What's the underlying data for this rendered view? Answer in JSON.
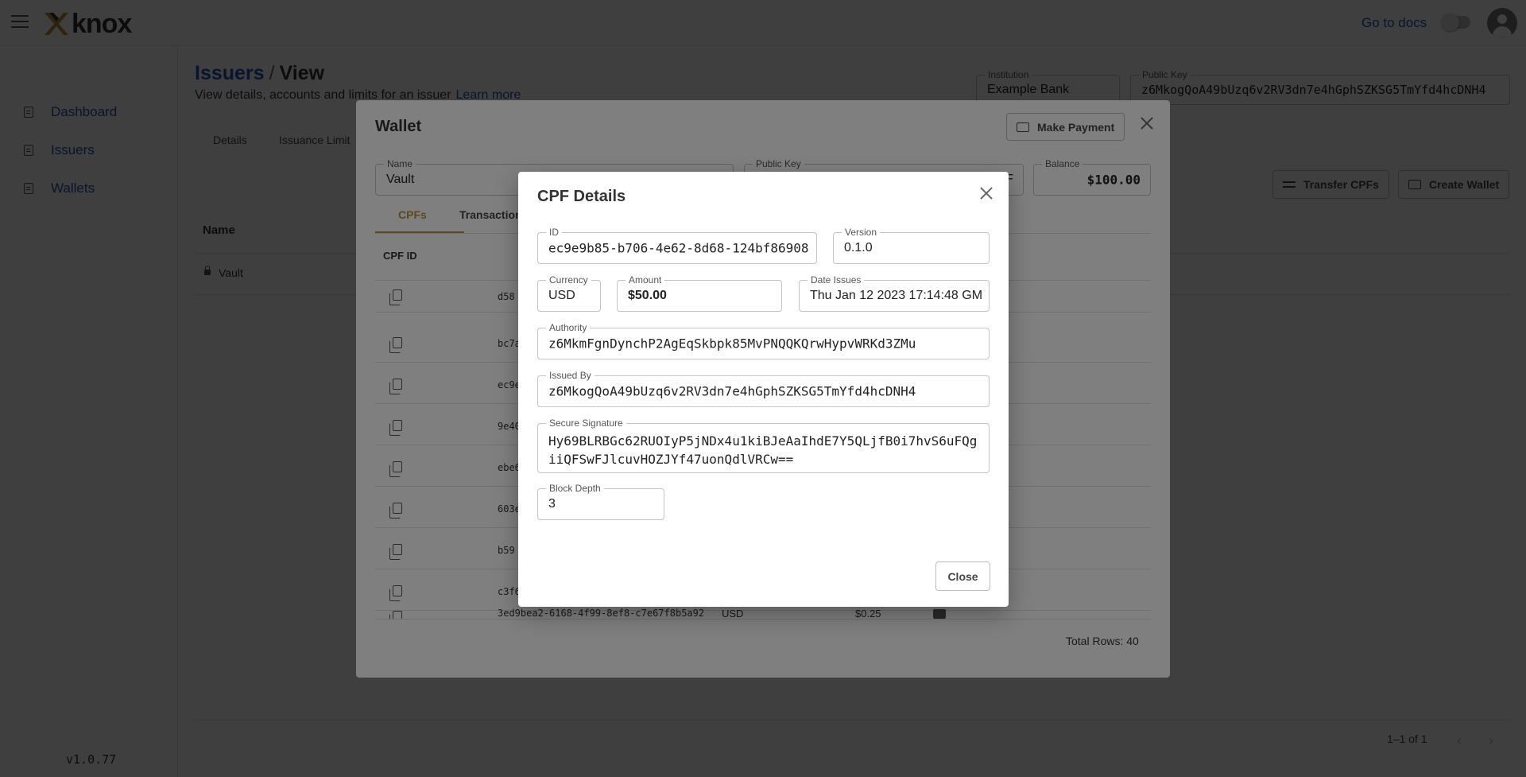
{
  "app": {
    "logo": "knox",
    "docs_link": "Go to docs",
    "version": "v1.0.77"
  },
  "sidebar": {
    "items": [
      {
        "label": "Dashboard"
      },
      {
        "label": "Issuers"
      },
      {
        "label": "Wallets"
      }
    ]
  },
  "page": {
    "breadcrumb_link": "Issuers",
    "breadcrumb_sep": "/",
    "breadcrumb_current": "View",
    "subtitle": "View details, accounts and limits for an issuer",
    "learn_more": "Learn more",
    "institution_label": "Institution",
    "institution_value": "Example Bank",
    "public_key_label": "Public Key",
    "public_key_value": "z6MkogQoA49bUzq6v2RV3dn7e4hGphSZKSG5TmYfd4hcDNH4",
    "tabs": [
      {
        "label": "Details"
      },
      {
        "label": "Issuance Limit"
      }
    ],
    "transfer_button": "Transfer CPFs",
    "create_wallet_button": "Create Wallet",
    "table_header_name": "Name",
    "row_name": "Vault",
    "pagination": "1–1 of 1"
  },
  "wallet": {
    "title": "Wallet",
    "make_payment": "Make Payment",
    "name_label": "Name",
    "name_value": "Vault",
    "public_key_label": "Public Key",
    "public_key_value": "F",
    "balance_label": "Balance",
    "balance_value": "$100.00",
    "tabs": [
      {
        "label": "CPFs"
      },
      {
        "label": "Transaction"
      }
    ],
    "column_header": "CPF ID",
    "rows": [
      {
        "id": "d58"
      },
      {
        "id": "bc7a"
      },
      {
        "id": "ec9e"
      },
      {
        "id": "9e40"
      },
      {
        "id": "ebe6"
      },
      {
        "id": "603e"
      },
      {
        "id": "b59"
      },
      {
        "id": "c3f6"
      }
    ],
    "last_row": {
      "id": "3ed9bea2-6168-4f99-8ef8-c7e67f8b5a92",
      "currency": "USD",
      "amount": "$0.25"
    },
    "total_rows": "Total Rows: 40",
    "accent_color": "#b8913a"
  },
  "cpf": {
    "title": "CPF Details",
    "id_label": "ID",
    "id_value": "ec9e9b85-b706-4e62-8d68-124bf86908",
    "version_label": "Version",
    "version_value": "0.1.0",
    "currency_label": "Currency",
    "currency_value": "USD",
    "amount_label": "Amount",
    "amount_value": "$50.00",
    "date_label": "Date Issues",
    "date_value": "Thu Jan 12 2023 17:14:48 GM",
    "authority_label": "Authority",
    "authority_value": "z6MkmFgnDynchP2AgEqSkbpk85MvPNQQKQrwHypvWRKd3ZMu",
    "issued_by_label": "Issued By",
    "issued_by_value": "z6MkogQoA49bUzq6v2RV3dn7e4hGphSZKSG5TmYfd4hcDNH4",
    "signature_label": "Secure Signature",
    "signature_value": "Hy69BLRBGc62RUOIyP5jNDx4u1kiBJeAaIhdE7Y5QLjfB0i7hvS6uFQgiiQFSwFJlcuvHOZJYf47uonQdlVRCw==",
    "block_depth_label": "Block Depth",
    "block_depth_value": "3",
    "close_button": "Close"
  }
}
